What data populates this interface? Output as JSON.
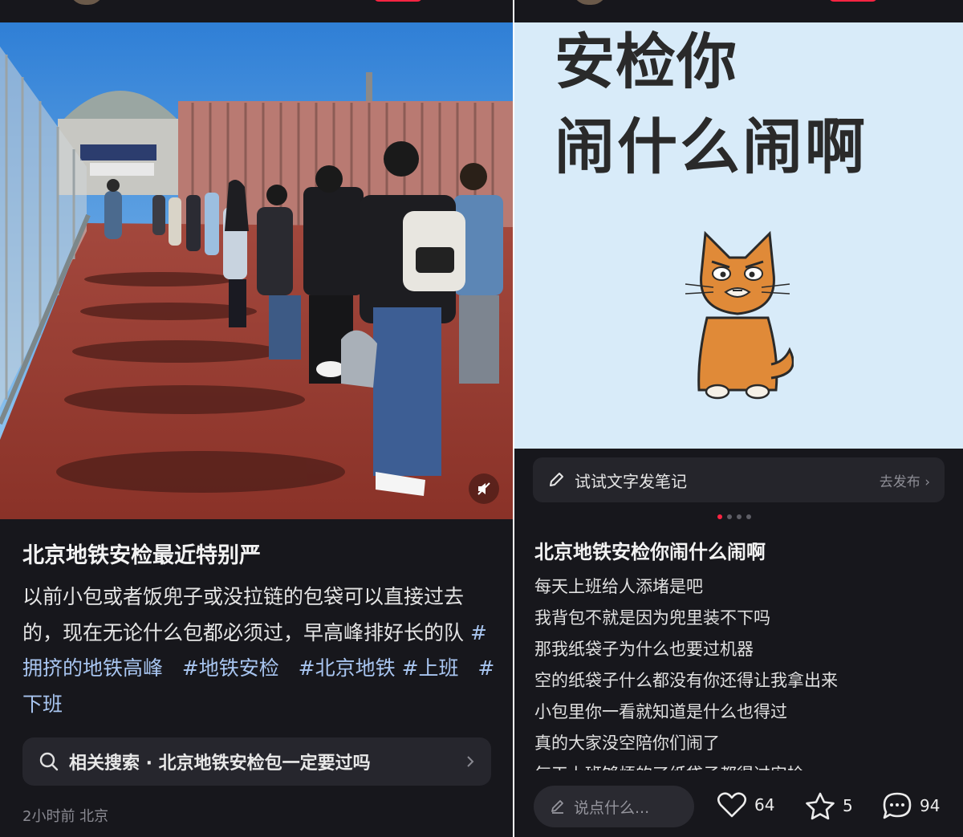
{
  "left_note": {
    "title": "北京地铁安检最近特别严",
    "body_text": "以前小包或者饭兜子或没拉链的包袋可以直接过去的，现在无论什么包都必须过，早高峰排好长的队",
    "tags": [
      "#拥挤的地铁高峰",
      "#地铁安检",
      "#北京地铁",
      "#上班",
      "#下班"
    ],
    "related_search": "相关搜索 · 北京地铁安检包一定要过吗",
    "meta": "2小时前 北京",
    "icons": {
      "search": "search-icon",
      "chevron": "chevron-right-icon",
      "mute": "mute-icon"
    },
    "colors": {
      "tag": "#a8c5f0",
      "accent": "#ff2442"
    }
  },
  "right_note": {
    "poster_line1": "安检你",
    "poster_line2": "闹什么闹啊",
    "publish_prompt": "试试文字发笔记",
    "publish_link": "去发布 ›",
    "carousel": {
      "total": 4,
      "active": 1
    },
    "title": "北京地铁安检你闹什么闹啊",
    "lines": [
      "每天上班给人添堵是吧",
      "我背包不就是因为兜里装不下吗",
      "那我纸袋子为什么也要过机器",
      "空的纸袋子什么都没有你还得让我拿出来",
      "小包里你一看就知道是什么也得过",
      "真的大家没空陪你们闹了",
      "每天上班够烦的了纸袋子都得过安检"
    ],
    "comment_placeholder": "说点什么...",
    "likes": "64",
    "stars": "5",
    "comments": "94"
  }
}
